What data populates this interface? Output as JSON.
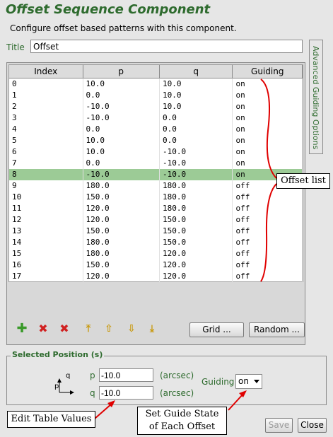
{
  "title": "Offset Sequence Component",
  "subtitle": "Configure offset based patterns with this component.",
  "title_field": {
    "label": "Title",
    "value": "Offset"
  },
  "advanced_tab": "Advanced Guiding Options",
  "table": {
    "headers": [
      "Index",
      "p",
      "q",
      "Guiding"
    ],
    "selected_index": 8,
    "rows": [
      [
        "0",
        "10.0",
        "10.0",
        "on"
      ],
      [
        "1",
        "0.0",
        "10.0",
        "on"
      ],
      [
        "2",
        "-10.0",
        "10.0",
        "on"
      ],
      [
        "3",
        "-10.0",
        "0.0",
        "on"
      ],
      [
        "4",
        "0.0",
        "0.0",
        "on"
      ],
      [
        "5",
        "10.0",
        "0.0",
        "on"
      ],
      [
        "6",
        "10.0",
        "-10.0",
        "on"
      ],
      [
        "7",
        "0.0",
        "-10.0",
        "on"
      ],
      [
        "8",
        "-10.0",
        "-10.0",
        "on"
      ],
      [
        "9",
        "180.0",
        "180.0",
        "off"
      ],
      [
        "10",
        "150.0",
        "180.0",
        "off"
      ],
      [
        "11",
        "120.0",
        "180.0",
        "off"
      ],
      [
        "12",
        "120.0",
        "150.0",
        "off"
      ],
      [
        "13",
        "150.0",
        "150.0",
        "off"
      ],
      [
        "14",
        "180.0",
        "150.0",
        "off"
      ],
      [
        "15",
        "180.0",
        "120.0",
        "off"
      ],
      [
        "16",
        "150.0",
        "120.0",
        "off"
      ],
      [
        "17",
        "120.0",
        "120.0",
        "off"
      ]
    ]
  },
  "toolbar": {
    "grid_label": "Grid ...",
    "random_label": "Random ..."
  },
  "selected_position": {
    "section_title": "Selected Position (s)",
    "axis_q": "q",
    "axis_p": "p",
    "p_label": "p",
    "p_value": "-10.0",
    "q_label": "q",
    "q_value": "-10.0",
    "units": "(arcsec)",
    "guiding_label": "Guiding",
    "guiding_value": "on"
  },
  "buttons": {
    "save": "Save",
    "close": "Close"
  },
  "callouts": {
    "offset_list": "Offset list",
    "edit_values": "Edit Table Values",
    "guide_state_line1": "Set Guide State",
    "guide_state_line2": "of Each Offset"
  },
  "colors": {
    "accent_green": "#2e6b2e",
    "selected_row": "#9ccb96",
    "annotation_red": "#e00000"
  }
}
